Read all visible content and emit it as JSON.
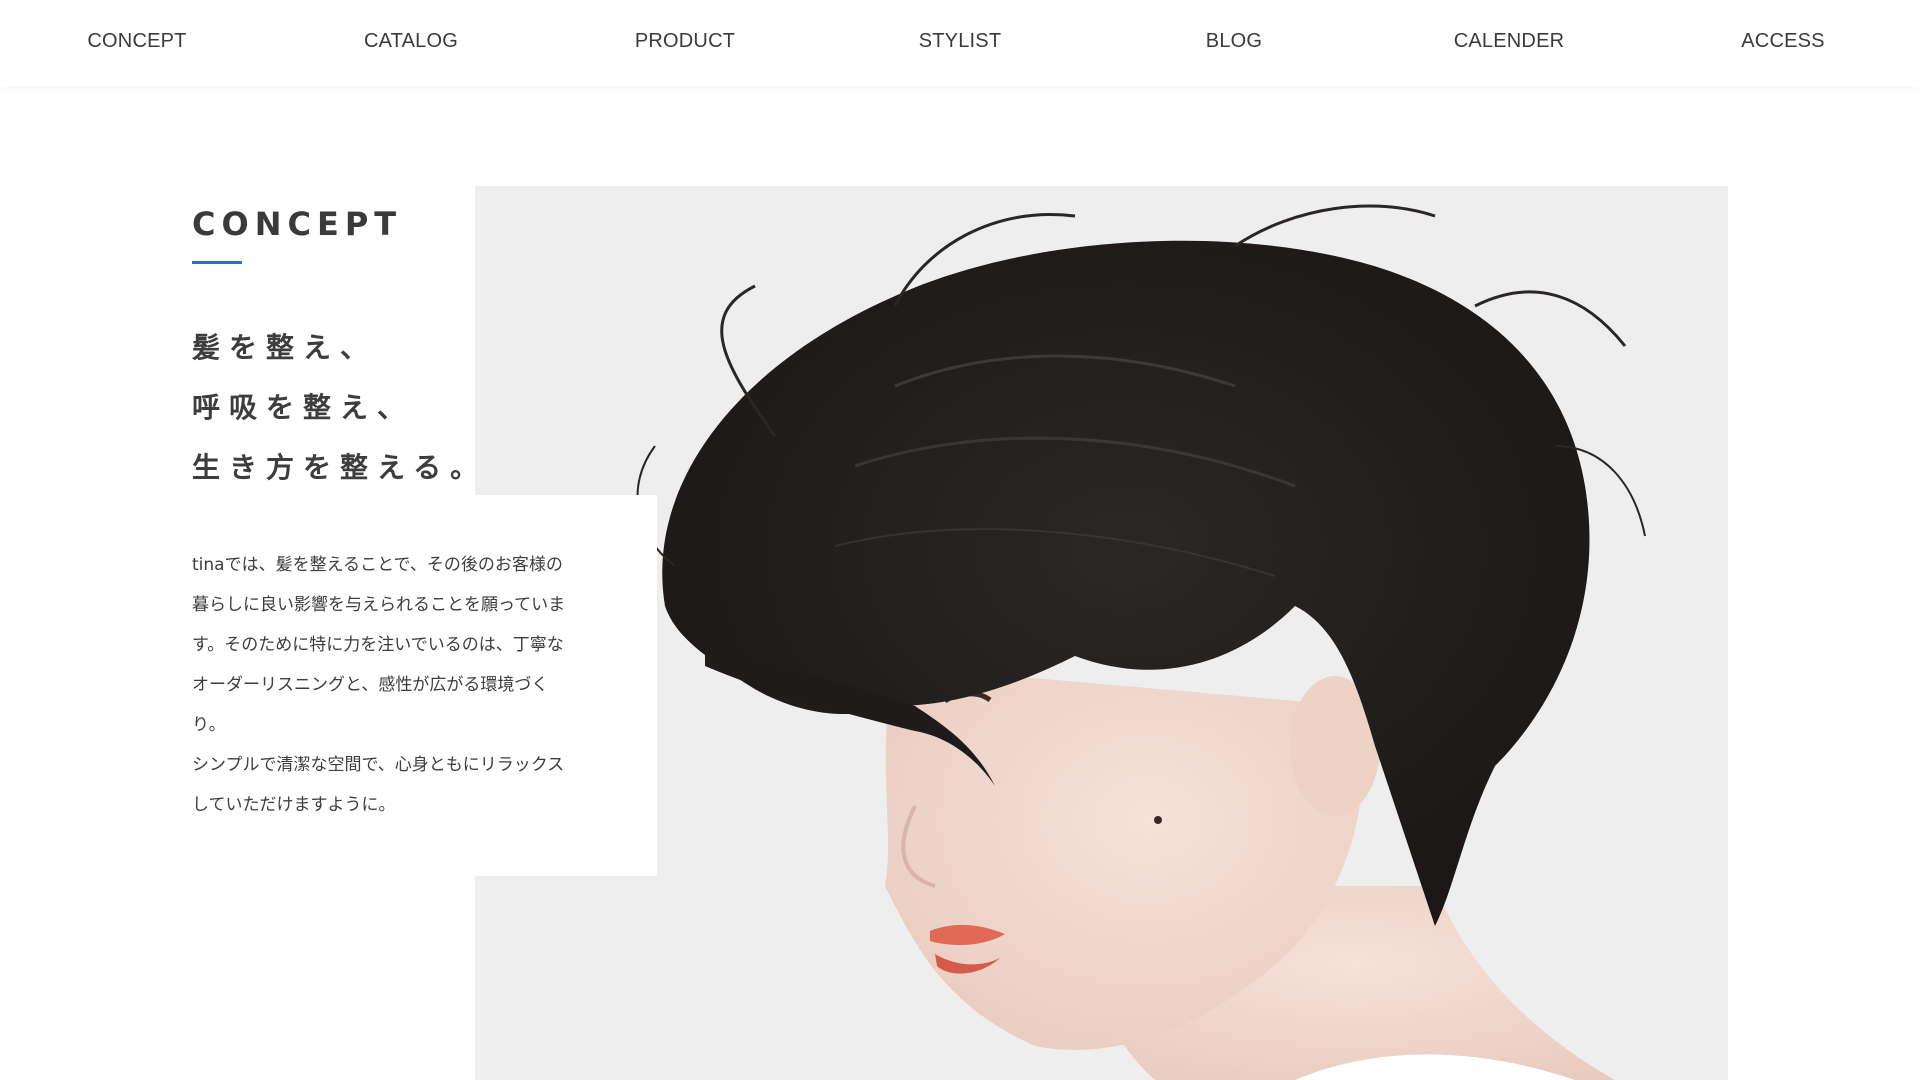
{
  "nav": {
    "items": [
      {
        "label": "CONCEPT"
      },
      {
        "label": "CATALOG"
      },
      {
        "label": "PRODUCT"
      },
      {
        "label": "STYLIST"
      },
      {
        "label": "BLOG"
      },
      {
        "label": "CALENDER"
      },
      {
        "label": "ACCESS"
      }
    ]
  },
  "concept": {
    "heading": "CONCEPT",
    "accent_color": "#2f6eb9",
    "catch_lines": [
      "髪を整え、",
      "呼吸を整え、",
      "生き方を整える。"
    ],
    "body_lines": [
      "tinaでは、髪を整えることで、その後のお客様の",
      "暮らしに良い影響を与えられることを願っていま",
      "す。そのために特に力を注いでいるのは、丁寧な",
      "オーダーリスニングと、感性が広がる環境づく",
      "り。",
      "シンプルで清潔な空間で、心身ともにリラックス",
      "していただけますように。"
    ]
  },
  "hero_image": {
    "icon": "portrait-photo-icon"
  }
}
